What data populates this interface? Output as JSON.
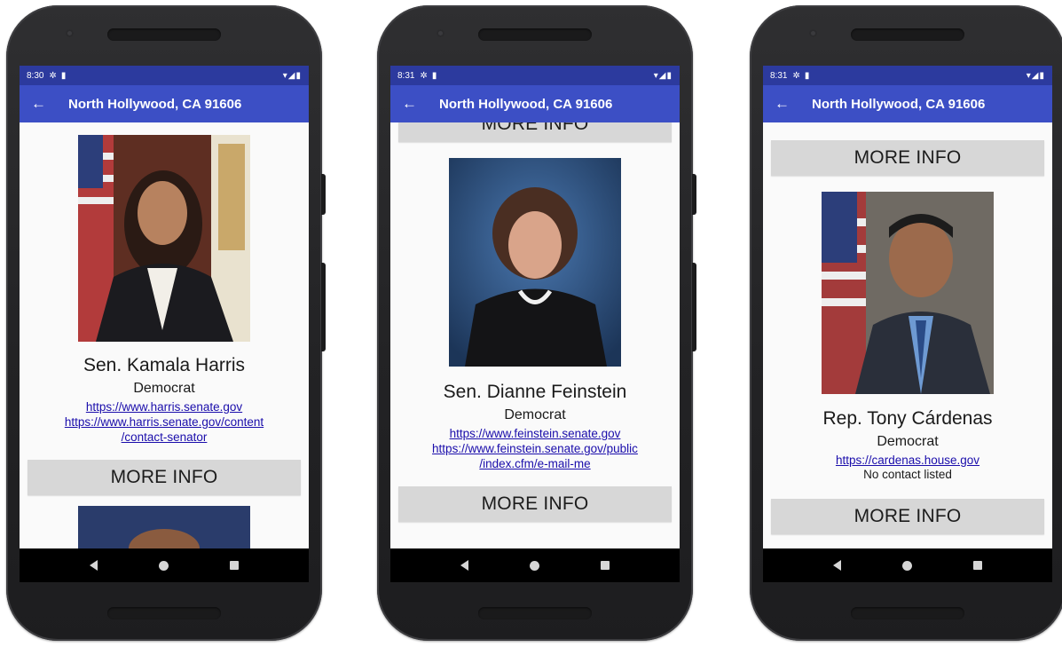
{
  "screens": [
    {
      "status": {
        "time": "8:30"
      },
      "appbar": {
        "back_icon": "arrow-left-icon",
        "title": "North Hollywood, CA 91606"
      },
      "rep": {
        "name": "Sen. Kamala Harris",
        "party": "Democrat",
        "link1": "https://www.harris.senate.gov",
        "link2_line1": "https://www.harris.senate.gov/content",
        "link2_line2": "/contact-senator"
      },
      "more_info_label": "MORE INFO"
    },
    {
      "status": {
        "time": "8:31"
      },
      "appbar": {
        "back_icon": "arrow-left-icon",
        "title": "North Hollywood, CA 91606"
      },
      "top_button_label": "MORE INFO",
      "rep": {
        "name": "Sen. Dianne Feinstein",
        "party": "Democrat",
        "link1": "https://www.feinstein.senate.gov",
        "link2_line1": "https://www.feinstein.senate.gov/public",
        "link2_line2": "/index.cfm/e-mail-me"
      },
      "more_info_label": "MORE INFO"
    },
    {
      "status": {
        "time": "8:31"
      },
      "appbar": {
        "back_icon": "arrow-left-icon",
        "title": "North Hollywood, CA 91606"
      },
      "top_button_label": "MORE INFO",
      "rep": {
        "name": "Rep. Tony Cárdenas",
        "party": "Democrat",
        "link1": "https://cardenas.house.gov",
        "contact_note": "No contact listed"
      },
      "more_info_label": "MORE INFO"
    }
  ],
  "colors": {
    "status_bar": "#2c3a9e",
    "app_bar": "#3c4fc5",
    "button_bg": "#d7d7d7",
    "link": "#1a0dab",
    "content_bg": "#fafafa"
  }
}
